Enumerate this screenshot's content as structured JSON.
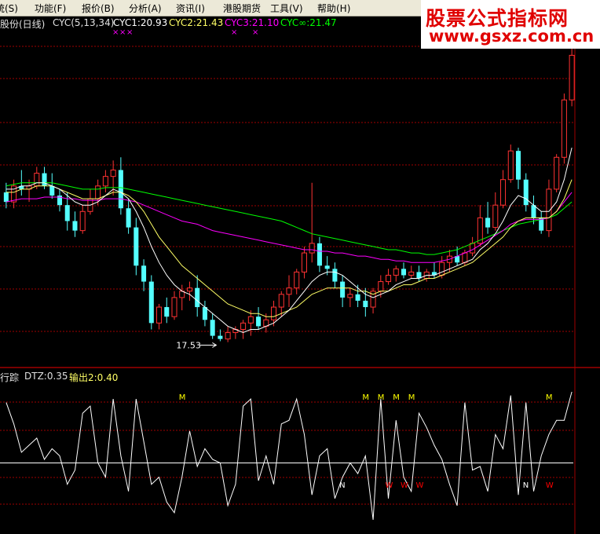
{
  "menu": [
    {
      "label": "统(S)",
      "x": -6
    },
    {
      "label": "功能(F)",
      "x": 44
    },
    {
      "label": "报价(B)",
      "x": 104
    },
    {
      "label": "分析(A)",
      "x": 164
    },
    {
      "label": "资讯(I)",
      "x": 224
    },
    {
      "label": "港股期货",
      "x": 284
    },
    {
      "label": "工具(V)",
      "x": 344
    },
    {
      "label": "帮助(H)",
      "x": 404
    }
  ],
  "watermark": {
    "line1": "股票公式指标网",
    "line2": "www.gsxz.com.cn"
  },
  "main_header": {
    "name": "股份(日线)",
    "indicator": "CYC(5,13,34)",
    "cyc1": "CYC1:20.93",
    "cyc2": "CYC2:21.43",
    "cyc3": "CYC3:21.10",
    "cycinf": "CYC∞:21.47",
    "marks": [
      "×",
      "×",
      "×",
      "×",
      "×"
    ]
  },
  "colors": {
    "up": "#ff3232",
    "down": "#54ffff",
    "cyc1": "#ffffff",
    "cyc2": "#ffff66",
    "cyc3": "#ff00ff",
    "cycinf": "#00ff00",
    "grid": "#a00000",
    "mark_m": "#ffff00",
    "mark_w": "#ff0000"
  },
  "low_label": "17.53",
  "sub_header": {
    "name": "行踪",
    "dtz": "DTZ:0.35",
    "out2": "输出2:0.40"
  },
  "signals": {
    "m_label": "M",
    "w_label": "W",
    "n_label": "N"
  },
  "chart_data": {
    "type": "candlestick",
    "candles": [
      [
        22.2,
        22.5,
        21.7,
        21.9
      ],
      [
        21.9,
        22.6,
        21.7,
        22.4
      ],
      [
        22.4,
        22.9,
        22.1,
        22.3
      ],
      [
        22.3,
        22.6,
        21.9,
        22.4
      ],
      [
        22.4,
        23.0,
        22.3,
        22.8
      ],
      [
        22.8,
        23.0,
        22.3,
        22.4
      ],
      [
        22.4,
        22.8,
        22.0,
        22.1
      ],
      [
        22.1,
        22.3,
        21.6,
        21.8
      ],
      [
        21.8,
        22.2,
        21.0,
        21.3
      ],
      [
        21.3,
        21.6,
        20.8,
        21.0
      ],
      [
        21.0,
        21.8,
        20.9,
        21.6
      ],
      [
        21.6,
        22.3,
        21.5,
        22.0
      ],
      [
        22.0,
        22.6,
        21.8,
        22.4
      ],
      [
        22.4,
        22.9,
        22.2,
        22.7
      ],
      [
        22.7,
        23.2,
        22.1,
        22.9
      ],
      [
        22.9,
        23.3,
        21.5,
        21.7
      ],
      [
        21.7,
        22.0,
        20.9,
        21.1
      ],
      [
        21.1,
        21.4,
        19.6,
        19.9
      ],
      [
        19.9,
        20.1,
        19.1,
        19.4
      ],
      [
        19.4,
        19.6,
        17.9,
        18.1
      ],
      [
        18.1,
        18.7,
        17.9,
        18.6
      ],
      [
        18.6,
        18.9,
        18.1,
        18.3
      ],
      [
        18.3,
        19.1,
        18.2,
        18.9
      ],
      [
        18.9,
        19.3,
        18.5,
        19.1
      ],
      [
        19.1,
        19.4,
        18.8,
        19.2
      ],
      [
        19.2,
        19.6,
        18.3,
        18.6
      ],
      [
        18.6,
        18.8,
        18.0,
        18.2
      ],
      [
        18.2,
        18.4,
        17.6,
        17.7
      ],
      [
        17.7,
        17.9,
        17.53,
        17.6
      ],
      [
        17.6,
        18.0,
        17.5,
        17.8
      ],
      [
        17.8,
        18.0,
        17.6,
        17.9
      ],
      [
        17.9,
        18.2,
        17.6,
        18.1
      ],
      [
        18.1,
        18.5,
        17.7,
        18.3
      ],
      [
        18.3,
        18.6,
        17.9,
        18.0
      ],
      [
        18.0,
        18.4,
        17.8,
        18.2
      ],
      [
        18.2,
        18.8,
        18.0,
        18.6
      ],
      [
        18.6,
        19.1,
        18.3,
        19.0
      ],
      [
        19.0,
        19.6,
        18.6,
        19.2
      ],
      [
        19.2,
        19.8,
        19.0,
        19.7
      ],
      [
        19.7,
        20.5,
        19.5,
        20.3
      ],
      [
        20.3,
        22.5,
        20.0,
        20.6
      ],
      [
        20.6,
        20.8,
        19.7,
        19.9
      ],
      [
        19.9,
        20.2,
        19.6,
        19.8
      ],
      [
        19.8,
        20.0,
        19.2,
        19.4
      ],
      [
        19.4,
        19.6,
        18.6,
        18.9
      ],
      [
        18.9,
        19.2,
        18.6,
        19.0
      ],
      [
        19.0,
        19.3,
        18.6,
        18.8
      ],
      [
        18.8,
        19.2,
        18.3,
        18.6
      ],
      [
        18.6,
        19.2,
        18.4,
        19.1
      ],
      [
        19.1,
        19.6,
        18.9,
        19.4
      ],
      [
        19.4,
        19.8,
        19.3,
        19.6
      ],
      [
        19.6,
        19.9,
        19.4,
        19.8
      ],
      [
        19.8,
        20.0,
        19.5,
        19.6
      ],
      [
        19.6,
        19.9,
        19.5,
        19.7
      ],
      [
        19.7,
        19.9,
        19.4,
        19.5
      ],
      [
        19.5,
        19.8,
        19.4,
        19.7
      ],
      [
        19.7,
        20.0,
        19.5,
        19.6
      ],
      [
        19.6,
        20.2,
        19.5,
        20.0
      ],
      [
        20.0,
        20.4,
        19.7,
        20.2
      ],
      [
        20.2,
        20.5,
        19.9,
        20.0
      ],
      [
        20.0,
        20.4,
        19.9,
        20.3
      ],
      [
        20.3,
        20.8,
        20.2,
        20.6
      ],
      [
        20.6,
        21.8,
        20.5,
        21.4
      ],
      [
        21.4,
        21.9,
        20.9,
        21.1
      ],
      [
        21.1,
        22.2,
        21.0,
        21.8
      ],
      [
        21.8,
        22.9,
        21.7,
        22.6
      ],
      [
        22.6,
        23.7,
        22.5,
        23.5
      ],
      [
        23.5,
        23.6,
        22.3,
        22.6
      ],
      [
        22.6,
        22.8,
        21.6,
        21.8
      ],
      [
        21.8,
        22.1,
        21.2,
        21.4
      ],
      [
        21.4,
        21.6,
        20.9,
        21.0
      ],
      [
        21.0,
        22.6,
        20.8,
        22.3
      ],
      [
        22.3,
        23.4,
        22.2,
        23.3
      ],
      [
        23.3,
        25.3,
        23.1,
        25.1
      ],
      [
        25.1,
        27.2,
        24.9,
        26.5
      ]
    ],
    "cyc1": [
      22.3,
      22.3,
      22.4,
      22.4,
      22.5,
      22.5,
      22.4,
      22.3,
      22.1,
      21.9,
      21.8,
      21.8,
      21.9,
      22.1,
      22.3,
      22.2,
      22.0,
      21.6,
      21.1,
      20.5,
      20.0,
      19.6,
      19.3,
      19.1,
      19.0,
      18.8,
      18.6,
      18.4,
      18.2,
      18.0,
      17.9,
      17.8,
      17.9,
      17.9,
      18.0,
      18.1,
      18.3,
      18.5,
      18.8,
      19.1,
      19.4,
      19.6,
      19.7,
      19.7,
      19.6,
      19.4,
      19.2,
      19.0,
      18.9,
      19.0,
      19.1,
      19.3,
      19.4,
      19.5,
      19.5,
      19.6,
      19.6,
      19.7,
      19.8,
      19.9,
      20.0,
      20.1,
      20.4,
      20.6,
      20.9,
      21.3,
      21.8,
      22.1,
      22.0,
      21.8,
      21.6,
      21.6,
      21.9,
      22.6,
      23.6
    ],
    "cyc2": [
      22.2,
      22.2,
      22.3,
      22.3,
      22.4,
      22.4,
      22.4,
      22.3,
      22.2,
      22.1,
      22.0,
      22.0,
      22.0,
      22.1,
      22.2,
      22.2,
      22.1,
      21.9,
      21.6,
      21.2,
      20.8,
      20.5,
      20.2,
      19.9,
      19.7,
      19.5,
      19.3,
      19.1,
      18.9,
      18.7,
      18.6,
      18.5,
      18.4,
      18.4,
      18.3,
      18.3,
      18.4,
      18.5,
      18.6,
      18.8,
      19.0,
      19.1,
      19.2,
      19.2,
      19.2,
      19.2,
      19.1,
      19.1,
      19.0,
      19.1,
      19.1,
      19.2,
      19.3,
      19.3,
      19.4,
      19.5,
      19.5,
      19.6,
      19.7,
      19.8,
      19.9,
      20.0,
      20.2,
      20.4,
      20.6,
      20.8,
      21.1,
      21.3,
      21.4,
      21.4,
      21.4,
      21.4,
      21.6,
      22.0,
      22.6
    ],
    "cyc3": [
      21.9,
      21.95,
      22.0,
      22.0,
      22.0,
      22.05,
      22.05,
      22.05,
      22.0,
      22.0,
      21.95,
      21.95,
      21.95,
      22.0,
      22.0,
      22.0,
      21.95,
      21.9,
      21.8,
      21.7,
      21.6,
      21.5,
      21.4,
      21.3,
      21.25,
      21.2,
      21.1,
      21.0,
      20.95,
      20.9,
      20.85,
      20.8,
      20.75,
      20.7,
      20.65,
      20.6,
      20.55,
      20.5,
      20.45,
      20.4,
      20.4,
      20.35,
      20.35,
      20.3,
      20.3,
      20.25,
      20.2,
      20.2,
      20.15,
      20.1,
      20.1,
      20.05,
      20.05,
      20.0,
      20.0,
      20.0,
      20.0,
      20.05,
      20.1,
      20.2,
      20.3,
      20.4,
      20.55,
      20.7,
      20.85,
      21.0,
      21.2,
      21.3,
      21.35,
      21.35,
      21.35,
      21.4,
      21.6,
      21.9,
      22.2
    ],
    "cycinf": [
      22.4,
      22.45,
      22.5,
      22.5,
      22.5,
      22.5,
      22.5,
      22.45,
      22.4,
      22.35,
      22.3,
      22.3,
      22.3,
      22.35,
      22.35,
      22.35,
      22.3,
      22.25,
      22.2,
      22.15,
      22.1,
      22.05,
      22.0,
      21.95,
      21.9,
      21.85,
      21.8,
      21.75,
      21.7,
      21.65,
      21.6,
      21.55,
      21.5,
      21.45,
      21.4,
      21.35,
      21.3,
      21.2,
      21.1,
      21.0,
      20.9,
      20.85,
      20.8,
      20.75,
      20.7,
      20.65,
      20.6,
      20.55,
      20.5,
      20.45,
      20.4,
      20.4,
      20.35,
      20.3,
      20.3,
      20.25,
      20.25,
      20.3,
      20.35,
      20.4,
      20.5,
      20.6,
      20.7,
      20.8,
      20.9,
      21.0,
      21.1,
      21.2,
      21.25,
      21.3,
      21.35,
      21.4,
      21.5,
      21.7,
      21.9
    ],
    "y_range": [
      17.0,
      27.2
    ],
    "sub_values": [
      0.85,
      0.55,
      0.15,
      0.25,
      0.35,
      0.05,
      0.2,
      0.1,
      -0.3,
      -0.1,
      0.7,
      0.8,
      0.0,
      -0.2,
      0.9,
      0.1,
      -0.4,
      0.9,
      0.3,
      -0.3,
      -0.2,
      -0.55,
      -0.7,
      -0.2,
      0.45,
      -0.05,
      0.2,
      0.05,
      0.0,
      -0.6,
      -0.3,
      0.8,
      0.9,
      -0.25,
      0.1,
      -0.3,
      0.55,
      0.6,
      0.9,
      0.4,
      -0.45,
      0.1,
      0.2,
      -0.5,
      -0.2,
      0.0,
      -0.15,
      0.1,
      -0.8,
      0.9,
      -0.5,
      0.6,
      -0.2,
      -0.4,
      0.7,
      0.5,
      0.25,
      0.05,
      -0.3,
      -0.6,
      0.85,
      -0.1,
      -0.05,
      -0.4,
      0.4,
      0.2,
      0.95,
      -0.45,
      0.85,
      -0.4,
      0.1,
      0.4,
      0.6,
      0.6,
      1.0
    ],
    "sub_range": [
      -1.0,
      1.1
    ],
    "m_marks": [
      23,
      47,
      49,
      51,
      53,
      71
    ],
    "w_marks": [
      50,
      52,
      54,
      71
    ],
    "n_marks": [
      44,
      68
    ],
    "low_index": 28
  }
}
